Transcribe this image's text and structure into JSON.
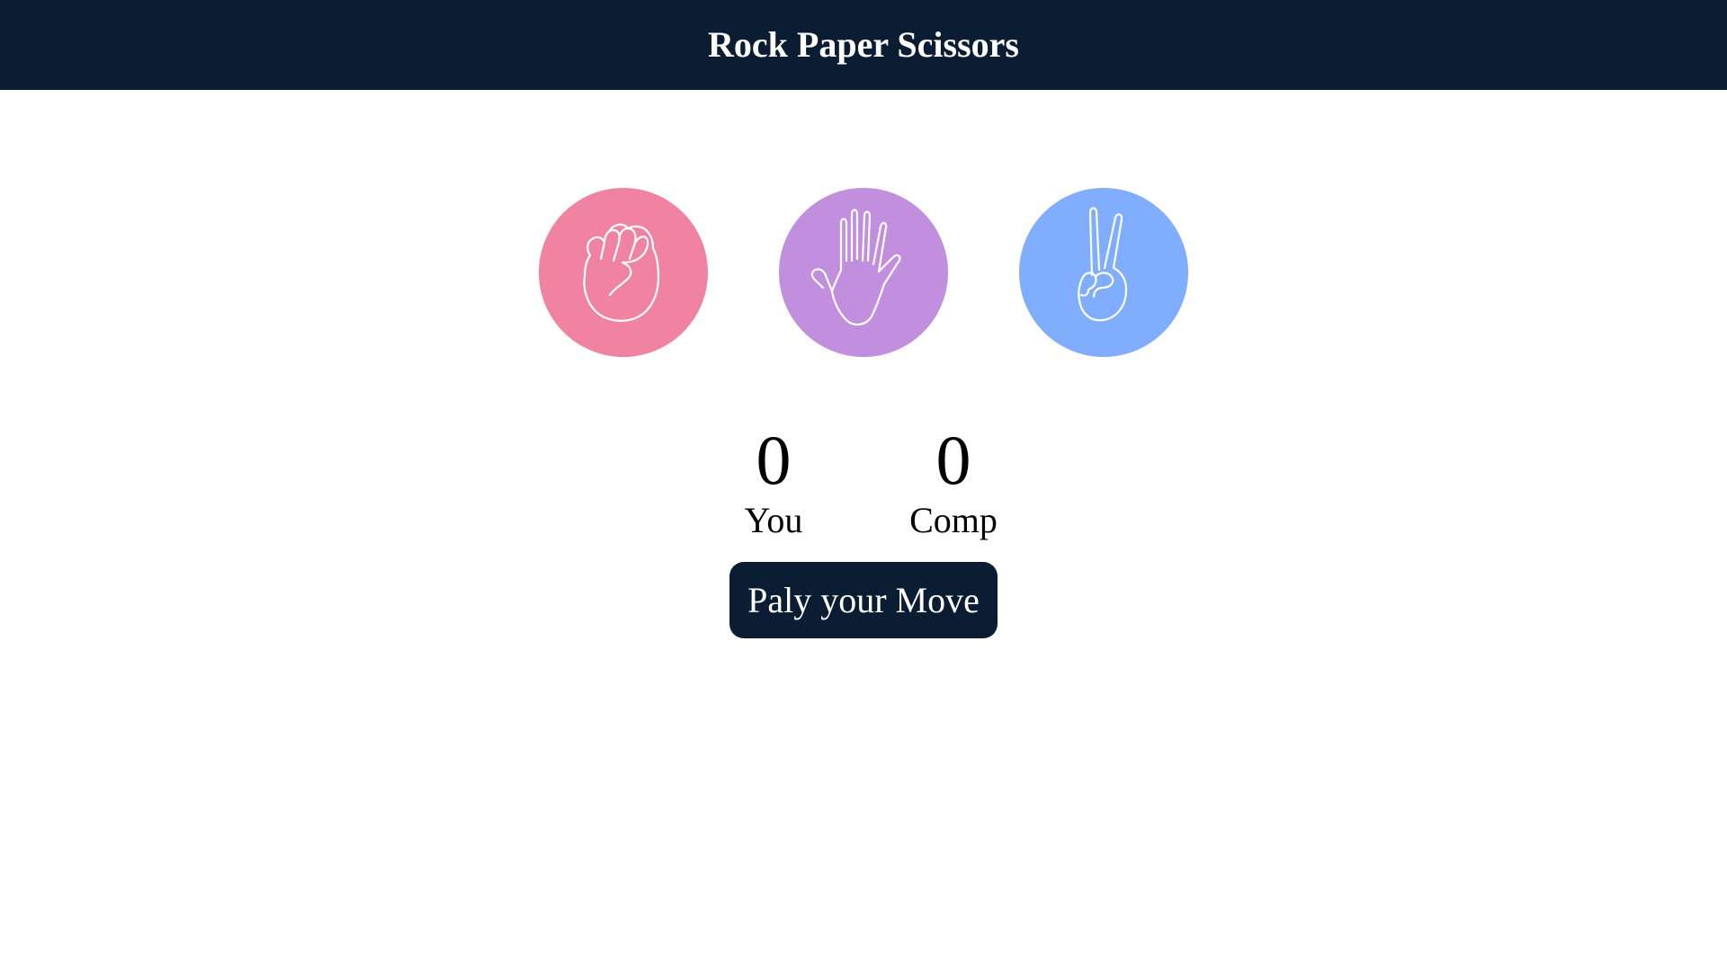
{
  "header": {
    "title": "Rock Paper Scissors",
    "background": "#0b1d33"
  },
  "choices": [
    {
      "id": "rock",
      "icon": "rock-hand-icon",
      "color": "#f083a1"
    },
    {
      "id": "paper",
      "icon": "paper-hand-icon",
      "color": "#c28ede"
    },
    {
      "id": "scissors",
      "icon": "scissors-hand-icon",
      "color": "#80adfe"
    }
  ],
  "scoreboard": {
    "user": {
      "score": "0",
      "label": "You"
    },
    "comp": {
      "score": "0",
      "label": "Comp"
    }
  },
  "message": {
    "text": "Paly your Move",
    "background": "#0b1d33"
  }
}
